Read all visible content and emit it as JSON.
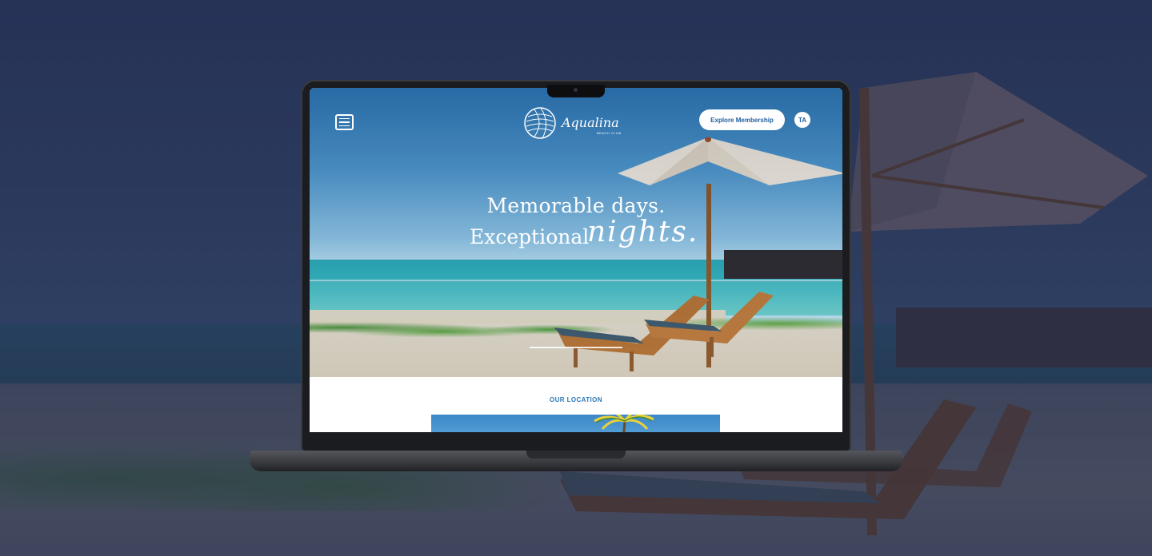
{
  "site": {
    "brand": "Aqualina",
    "brand_tagline": "BEACH CLUB",
    "nav": {
      "menu_icon": "hamburger-menu-icon",
      "cta_label": "Explore Membership",
      "language_label": "TA"
    },
    "hero": {
      "line1": "Memorable days.",
      "line2_prefix": "Exceptional",
      "line2_script": "nights."
    },
    "location": {
      "label": "OUR LOCATION"
    }
  },
  "colors": {
    "accent": "#2a78b8",
    "button_text": "#1f5f9c",
    "background_overlay": "#2e3a58"
  }
}
